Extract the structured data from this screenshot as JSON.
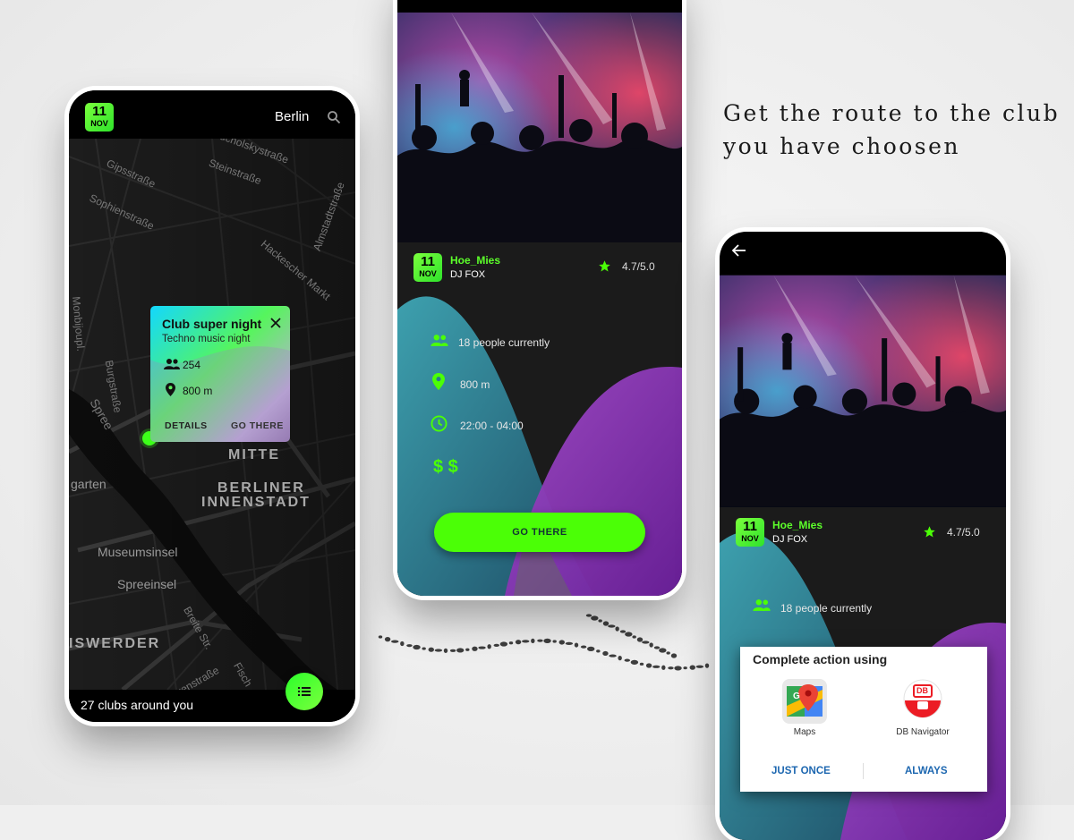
{
  "tagline": {
    "line1": "Get the route to the club",
    "line2": "you have choosen"
  },
  "colors": {
    "accent_green": "#4bff06",
    "teal": "#2a8fa0",
    "purple": "#8a2bb0",
    "dark": "#1b1b1b"
  },
  "map_screen": {
    "date": {
      "day": "11",
      "month": "NOV"
    },
    "city": "Berlin",
    "search_icon": "search-icon",
    "map_labels": {
      "street1": "Tucholskystraße",
      "street2": "Gipsstraße",
      "street3": "Steinstraße",
      "street4": "Sophienstraße",
      "street5": "Almstadtstraße",
      "street6": "Hackescher Markt",
      "street7": "Monbijoupl.",
      "street8": "Burgstraße",
      "street9": "Spree",
      "district1": "MITTE",
      "district2": "BERLINER",
      "district3": "INNENSTADT",
      "place1": "Museumsinsel",
      "place2": "Spreeinsel",
      "place3": "ISWERDER",
      "place4": "Breite Str.",
      "street10": "garten",
      "street11": "Fisch",
      "street12": "rrenstraße"
    },
    "popup": {
      "title": "Club super night",
      "subtitle": "Techno music night",
      "people": "254",
      "distance": "800 m",
      "details_label": "DETAILS",
      "go_label": "GO THERE"
    },
    "bottom_text": "27 clubs around you",
    "fab_icon": "list-icon"
  },
  "detail_screen": {
    "date": {
      "day": "11",
      "month": "NOV"
    },
    "venue": "Hoe_Mies",
    "dj": "DJ FOX",
    "rating": "4.7/5.0",
    "people": "18 people currently",
    "distance": "800 m",
    "hours": "22:00 - 04:00",
    "price": "$ $",
    "go_label": "GO THERE"
  },
  "route_screen": {
    "date": {
      "day": "11",
      "month": "NOV"
    },
    "venue": "Hoe_Mies",
    "dj": "DJ FOX",
    "rating": "4.7/5.0",
    "people": "18 people currently",
    "dialog": {
      "title": "Complete action using",
      "app1": "Maps",
      "app2": "DB Navigator",
      "db_logo": "DB",
      "btn_once": "JUST ONCE",
      "btn_always": "ALWAYS"
    }
  }
}
